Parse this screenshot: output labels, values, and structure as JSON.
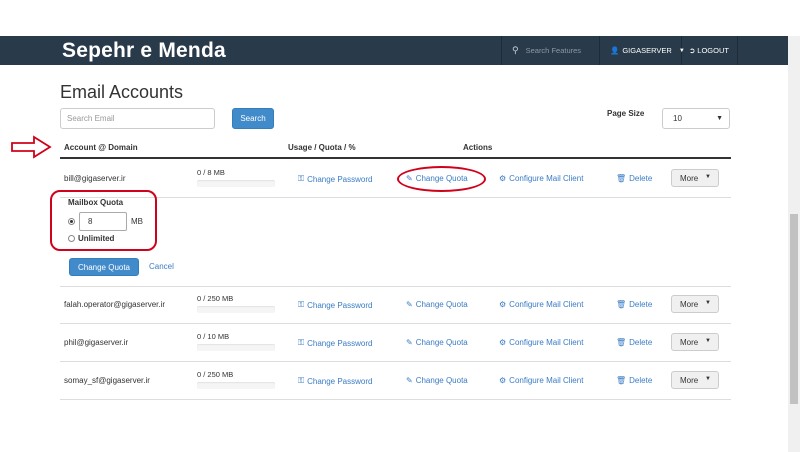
{
  "header": {
    "brand": "Sepehr e Menda",
    "search_placeholder": "Search Features",
    "user": "GIGASERVER",
    "logout": "LOGOUT"
  },
  "page": {
    "title": "Email Accounts",
    "search_placeholder": "Search Email",
    "search_button": "Search",
    "page_size_label": "Page Size",
    "page_size_value": "10"
  },
  "table": {
    "headers": [
      "Account @ Domain",
      "Usage / Quota / %",
      "Actions"
    ],
    "rows": [
      {
        "account": "bill@gigaserver.ir",
        "usage": "0 / 8 MB"
      },
      {
        "account": "falah.operator@gigaserver.ir",
        "usage": "0 / 250 MB"
      },
      {
        "account": "phil@gigaserver.ir",
        "usage": "0 / 10 MB"
      },
      {
        "account": "somay_sf@gigaserver.ir",
        "usage": "0 / 250 MB"
      }
    ],
    "actions": {
      "change_password": "Change Password",
      "change_quota": "Change Quota",
      "configure_mail_client": "Configure Mail Client",
      "delete": "Delete",
      "more": "More"
    }
  },
  "quota_editor": {
    "title": "Mailbox Quota",
    "value": "8",
    "unit": "MB",
    "unlimited_label": "Unlimited",
    "submit": "Change Quota",
    "cancel": "Cancel"
  },
  "colors": {
    "header_bg": "#293a4a",
    "primary": "#428bca",
    "link": "#3a7cc4",
    "annotation_red": "#d0021b"
  }
}
